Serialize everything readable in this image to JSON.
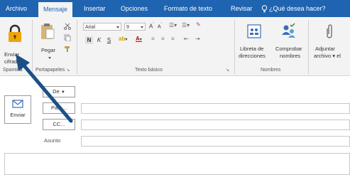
{
  "tabs": [
    {
      "label": "Archivo"
    },
    {
      "label": "Mensaje"
    },
    {
      "label": "Insertar"
    },
    {
      "label": "Opciones"
    },
    {
      "label": "Formato de texto"
    },
    {
      "label": "Revisar"
    }
  ],
  "tell_me": "¿Qué desea hacer?",
  "ribbon": {
    "encrypt_btn": {
      "line1": "Enviar",
      "line2": "cifrado"
    },
    "group_spamina": "Spamina",
    "paste_btn": "Pegar",
    "group_clipboard": "Portapapeles",
    "font_name": "Arial",
    "font_size": "9",
    "bold": "N",
    "italic": "K",
    "underline": "S",
    "group_basic_text": "Texto básico",
    "address_book": {
      "line1": "Libreta de",
      "line2": "direcciones"
    },
    "check_names": {
      "line1": "Comprobar",
      "line2": "nombres"
    },
    "group_names": "Nombres",
    "attach": {
      "line1": "Adjuntar",
      "line2": "archivo ▾ el"
    }
  },
  "compose": {
    "send": "Enviar",
    "from": "De",
    "to": "Para...",
    "cc": "CC...",
    "subject": "Asunto"
  },
  "colors": {
    "accent": "#1f64b0",
    "arrow": "#1c4f86"
  }
}
